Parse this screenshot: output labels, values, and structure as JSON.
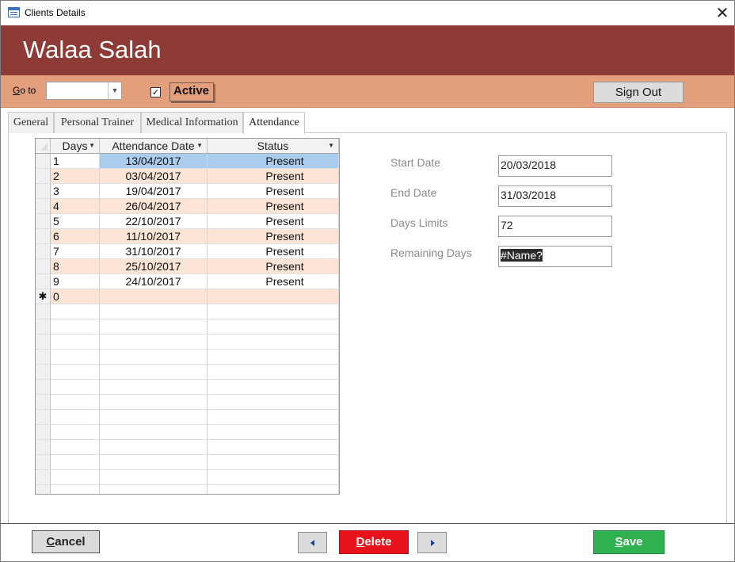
{
  "window": {
    "title": "Clients Details",
    "close_icon": "close-icon"
  },
  "header": {
    "client_name": "Walaa Salah",
    "band_color": "#8e3b38"
  },
  "toolbar": {
    "goto_label_prefix": "G",
    "goto_label_rest": "o to",
    "goto_value": "",
    "active_checked": true,
    "active_label": "Active",
    "signout_label": "Sign Out",
    "band_color": "#e39e7c"
  },
  "tabs": [
    {
      "label": "General",
      "selected": false
    },
    {
      "label": "Personal Trainer",
      "selected": false
    },
    {
      "label": "Medical Information",
      "selected": false
    },
    {
      "label": "Attendance",
      "selected": true
    }
  ],
  "attendance": {
    "columns": [
      "Days",
      "Attendance Date",
      "Status"
    ],
    "rows": [
      {
        "days": "1",
        "date": "13/04/2017",
        "status": "Present",
        "selected": true
      },
      {
        "days": "2",
        "date": "03/04/2017",
        "status": "Present"
      },
      {
        "days": "3",
        "date": "19/04/2017",
        "status": "Present"
      },
      {
        "days": "4",
        "date": "26/04/2017",
        "status": "Present"
      },
      {
        "days": "5",
        "date": "22/10/2017",
        "status": "Present"
      },
      {
        "days": "6",
        "date": "11/10/2017",
        "status": "Present"
      },
      {
        "days": "7",
        "date": "31/10/2017",
        "status": "Present"
      },
      {
        "days": "8",
        "date": "25/10/2017",
        "status": "Present"
      },
      {
        "days": "9",
        "date": "24/10/2017",
        "status": "Present"
      }
    ],
    "new_row": {
      "marker": "✱",
      "days": "0",
      "date": "",
      "status": ""
    },
    "alt_row_color": "#fce4d6",
    "selected_row_color": "#aacdee"
  },
  "fields": {
    "start_date": {
      "label": "Start Date",
      "value": "20/03/2018"
    },
    "end_date": {
      "label": "End Date",
      "value": "31/03/2018"
    },
    "days_limits": {
      "label": "Days Limits",
      "value": "72"
    },
    "remaining_days": {
      "label": "Remaining Days",
      "value": "#Name?"
    }
  },
  "buttons": {
    "cancel_prefix": "C",
    "cancel_rest": "ancel",
    "delete_prefix": "D",
    "delete_rest": "elete",
    "save_prefix": "S",
    "save_rest": "ave",
    "prev_icon": "triangle-left-icon",
    "next_icon": "triangle-right-icon",
    "delete_color": "#e8121b",
    "save_color": "#2fb14f"
  }
}
